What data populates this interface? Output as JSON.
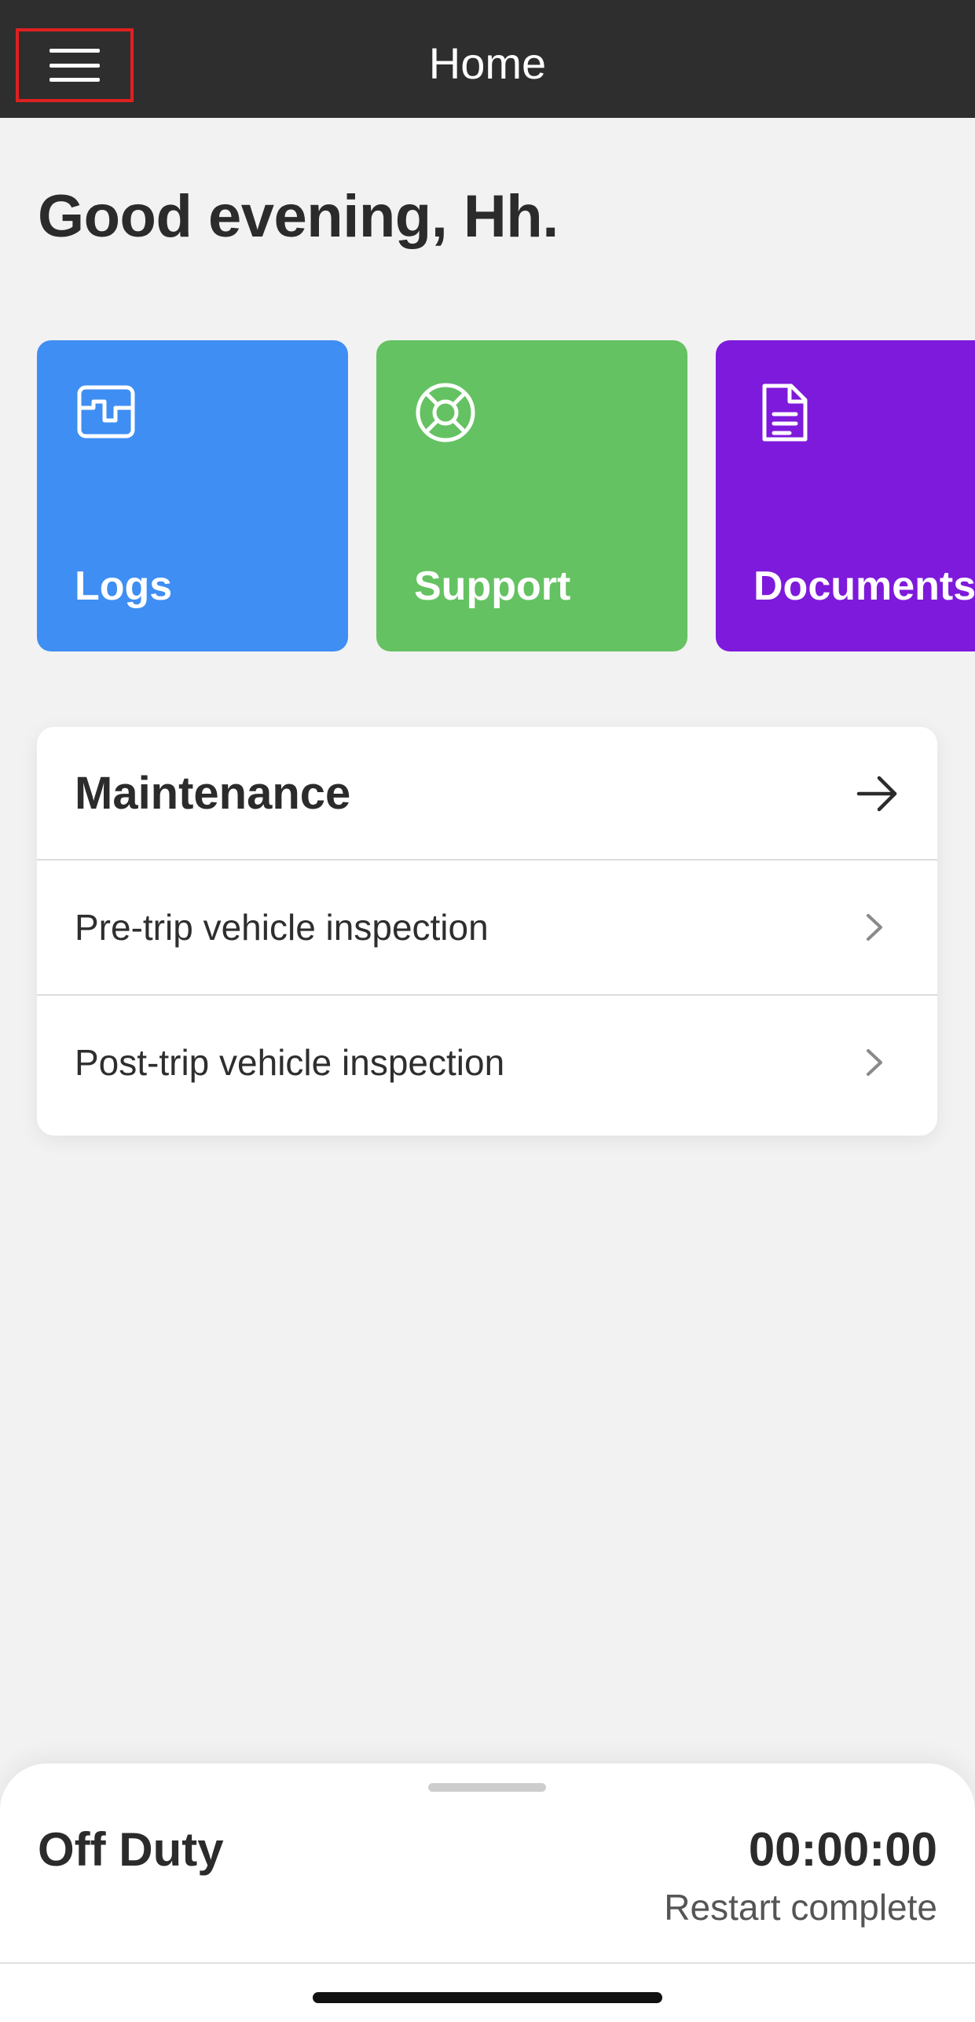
{
  "app_bar": {
    "title": "Home",
    "menu_icon": "hamburger-menu-icon"
  },
  "greeting": "Good evening, Hh.",
  "tiles": [
    {
      "label": "Logs",
      "icon": "logs-graph-icon",
      "color": "#3f8ef3"
    },
    {
      "label": "Support",
      "icon": "lifebuoy-icon",
      "color": "#65c262"
    },
    {
      "label": "Documents",
      "icon": "document-icon",
      "color": "#7e1adb"
    }
  ],
  "maintenance": {
    "title": "Maintenance",
    "header_icon": "arrow-right-icon",
    "items": [
      {
        "label": "Pre-trip vehicle inspection",
        "icon": "chevron-right-icon"
      },
      {
        "label": "Post-trip vehicle inspection",
        "icon": "chevron-right-icon"
      }
    ]
  },
  "status_sheet": {
    "duty_status": "Off Duty",
    "timer": "00:00:00",
    "subtitle": "Restart complete"
  },
  "colors": {
    "app_bar": "#2e2e2e",
    "background": "#f2f2f2",
    "highlight_border": "#e02020"
  }
}
